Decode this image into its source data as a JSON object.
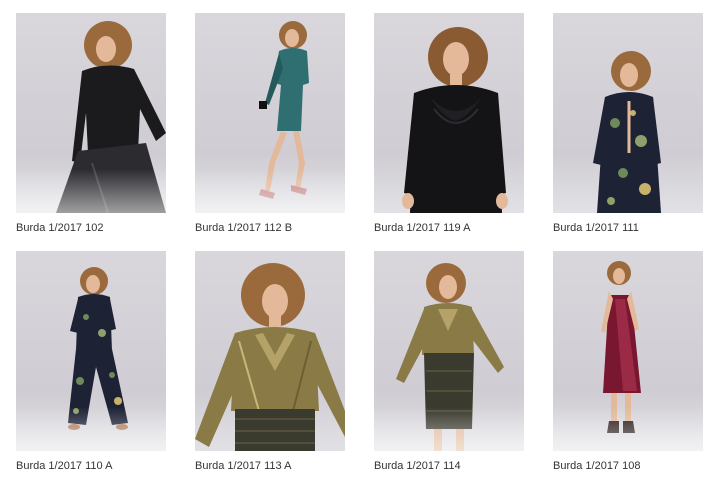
{
  "products": [
    {
      "caption": "Burda 1/2017 102",
      "outfit_color": "#1b1a1d",
      "accent_color": "#2c2b30"
    },
    {
      "caption": "Burda 1/2017 112 B",
      "outfit_color": "#2f6f72",
      "accent_color": "#255a5d"
    },
    {
      "caption": "Burda 1/2017 119 A",
      "outfit_color": "#141416",
      "accent_color": "#202024"
    },
    {
      "caption": "Burda 1/2017 111",
      "outfit_color": "#1d2235",
      "accent_color": "#6e8a5a"
    },
    {
      "caption": "Burda 1/2017 110 A",
      "outfit_color": "#1d2235",
      "accent_color": "#6e8a5a"
    },
    {
      "caption": "Burda 1/2017 113 A",
      "outfit_color": "#8a7a45",
      "accent_color": "#3b3a2f"
    },
    {
      "caption": "Burda 1/2017 114",
      "outfit_color": "#8a7a45",
      "accent_color": "#3b3a2f"
    },
    {
      "caption": "Burda 1/2017 108",
      "outfit_color": "#7a1730",
      "accent_color": "#5e0f24"
    }
  ]
}
